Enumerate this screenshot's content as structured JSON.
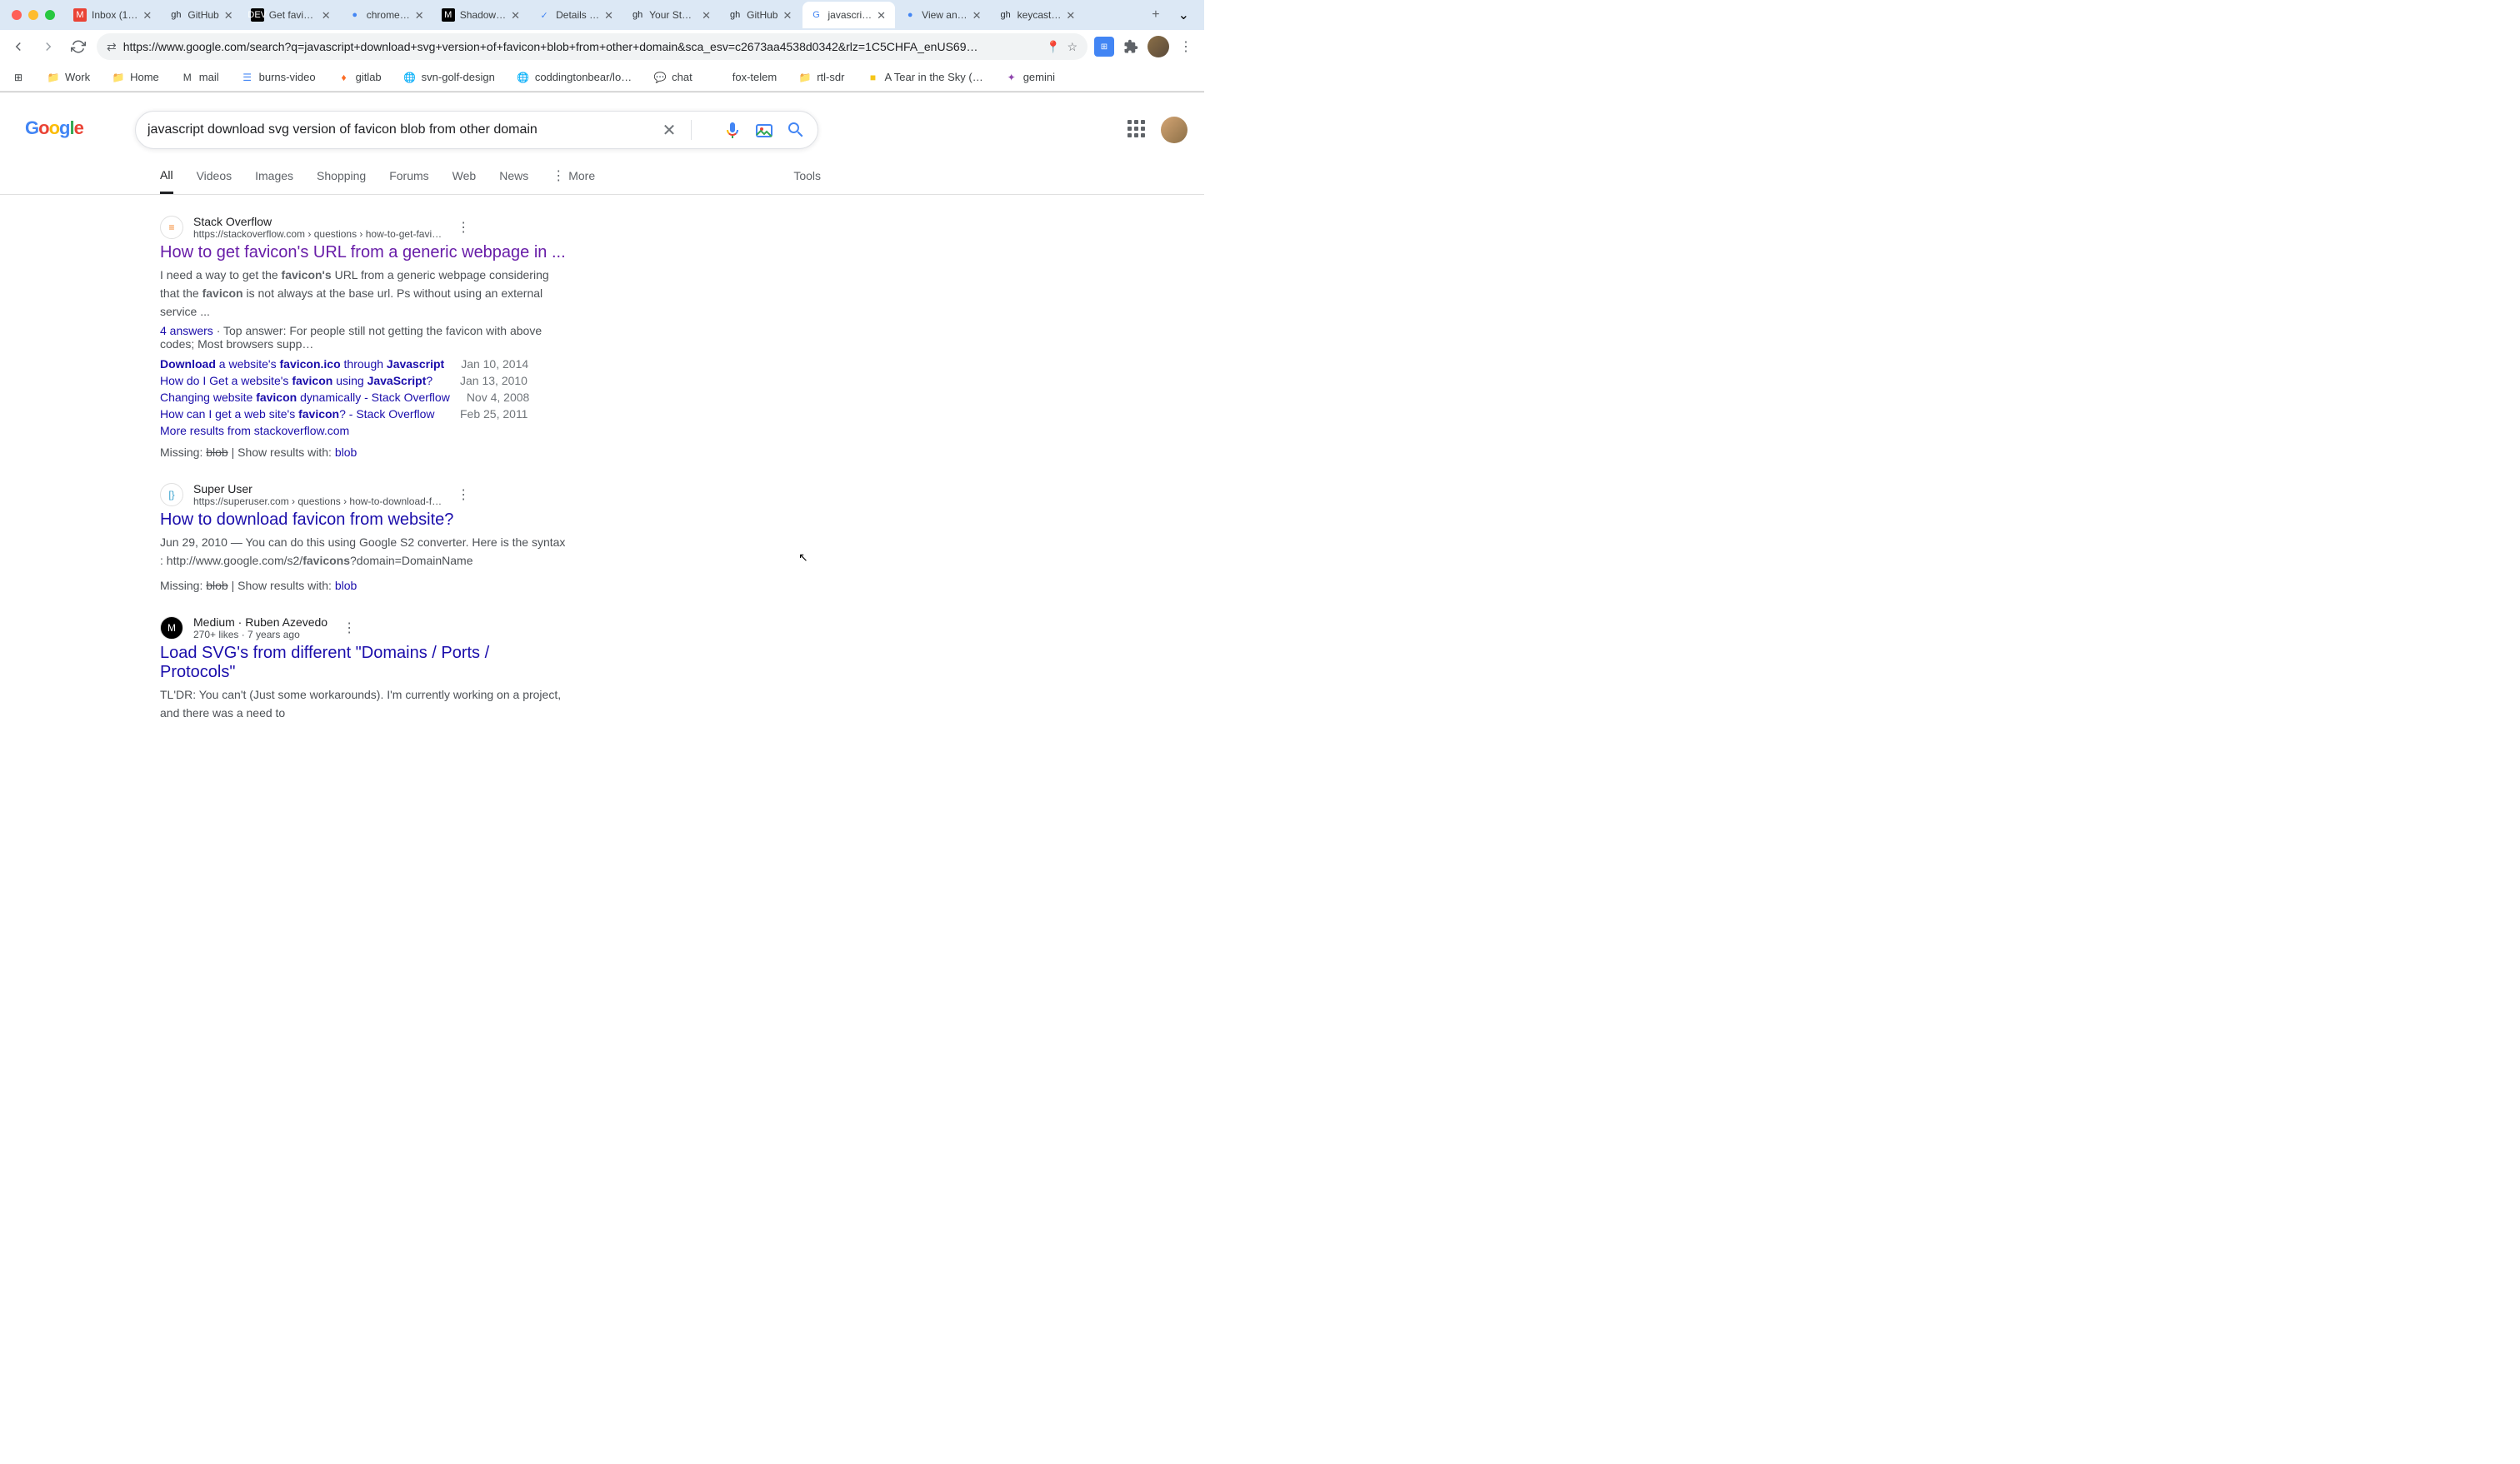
{
  "browser": {
    "tabs": [
      {
        "favicon": "M",
        "favicon_bg": "#ea4335",
        "title": "Inbox (1…"
      },
      {
        "favicon": "gh",
        "favicon_color": "#24292f",
        "title": "GitHub"
      },
      {
        "favicon": "DEV",
        "favicon_bg": "#000",
        "title": "Get favic…"
      },
      {
        "favicon": "●",
        "favicon_color": "#4285f4",
        "title": "chrome…"
      },
      {
        "favicon": "M",
        "favicon_bg": "#000",
        "title": "Shadow…"
      },
      {
        "favicon": "✓",
        "favicon_color": "#4285f4",
        "title": "Details …"
      },
      {
        "favicon": "gh",
        "favicon_color": "#24292f",
        "title": "Your Sta…"
      },
      {
        "favicon": "gh",
        "favicon_color": "#24292f",
        "title": "GitHub"
      },
      {
        "favicon": "G",
        "favicon_color": "#4285f4",
        "title": "javascri…",
        "active": true
      },
      {
        "favicon": "●",
        "favicon_color": "#4285f4",
        "title": "View an…"
      },
      {
        "favicon": "gh",
        "favicon_color": "#24292f",
        "title": "keycast…"
      }
    ],
    "url": "https://www.google.com/search?q=javascript+download+svg+version+of+favicon+blob+from+other+domain&sca_esv=c2673aa4538d0342&rlz=1C5CHFA_enUS69…",
    "bookmarks": [
      {
        "icon": "⊞",
        "label": ""
      },
      {
        "icon": "📁",
        "label": "Work"
      },
      {
        "icon": "📁",
        "label": "Home"
      },
      {
        "icon": "M",
        "label": "mail"
      },
      {
        "icon": "☰",
        "label": "burns-video",
        "color": "#4285f4"
      },
      {
        "icon": "♦",
        "label": "gitlab",
        "color": "#fc6d26"
      },
      {
        "icon": "🌐",
        "label": "svn-golf-design"
      },
      {
        "icon": "🌐",
        "label": "coddingtonbear/lo…"
      },
      {
        "icon": "💬",
        "label": "chat"
      },
      {
        "icon": "",
        "label": "fox-telem"
      },
      {
        "icon": "📁",
        "label": "rtl-sdr"
      },
      {
        "icon": "■",
        "label": "A Tear in the Sky (…",
        "color": "#f5c518"
      },
      {
        "icon": "✦",
        "label": "gemini",
        "color": "#8e44ad"
      }
    ]
  },
  "search": {
    "query": "javascript download svg version of favicon blob from other domain",
    "filters": [
      "All",
      "Videos",
      "Images",
      "Shopping",
      "Forums",
      "Web",
      "News"
    ],
    "more_label": "More",
    "tools_label": "Tools"
  },
  "results": [
    {
      "site_name": "Stack Overflow",
      "url_display": "https://stackoverflow.com › questions › how-to-get-favi…",
      "favicon_text": "≡",
      "favicon_color": "#f48024",
      "title": "How to get favicon's URL from a generic webpage in ...",
      "visited": true,
      "snippet_pre": "I need a way to get the ",
      "snippet_bold1": "favicon's",
      "snippet_mid": " URL from a generic webpage considering that the ",
      "snippet_bold2": "favicon",
      "snippet_post": " is not always at the base url. Ps without using an external service ...",
      "answers": "4 answers",
      "top_answer_label": "Top answer:",
      "top_answer_text": "For people still not getting the favicon with above codes; Most browsers supp…",
      "sub_results": [
        {
          "text_pre": "Download",
          "text_mid": " a website's ",
          "text_bold": "favicon.ico",
          "text_post": " through ",
          "text_bold2": "Javascript",
          "date": "Jan 10, 2014"
        },
        {
          "text_pre": "How do I Get a website's ",
          "text_bold": "favicon",
          "text_mid": " using ",
          "text_bold2": "JavaScript",
          "text_post": "?",
          "date": "Jan 13, 2010"
        },
        {
          "text_pre": "Changing website ",
          "text_bold": "favicon",
          "text_post": " dynamically - Stack Overflow",
          "date": "Nov 4, 2008"
        },
        {
          "text_pre": "How can I get a web site's ",
          "text_bold": "favicon",
          "text_post": "? - Stack Overflow",
          "date": "Feb 25, 2011"
        }
      ],
      "more_results": "More results from stackoverflow.com",
      "missing_label": "Missing:",
      "missing_term": "blob",
      "show_results_label": "Show results with:",
      "show_results_term": "blob"
    },
    {
      "site_name": "Super User",
      "url_display": "https://superuser.com › questions › how-to-download-f…",
      "favicon_text": "[}",
      "favicon_color": "#38a1ce",
      "title": "How to download favicon from website?",
      "visited": false,
      "date_prefix": "Jun 29, 2010",
      "snippet_pre": " — You can do this using Google S2 converter. Here is the syntax : http://www.google.com/s2/",
      "snippet_bold1": "favicons",
      "snippet_post": "?domain=DomainName",
      "missing_label": "Missing:",
      "missing_term": "blob",
      "show_results_label": "Show results with:",
      "show_results_term": "blob"
    },
    {
      "site_name": "Medium · Ruben Azevedo",
      "url_display": "270+ likes · 7 years ago",
      "favicon_text": "M",
      "favicon_bg": "#000",
      "title": "Load SVG's from different \"Domains / Ports / Protocols\"",
      "visited": false,
      "snippet_pre": "TL'DR: You can't (Just some workarounds). I'm currently working on a project, and there was a need to"
    }
  ]
}
